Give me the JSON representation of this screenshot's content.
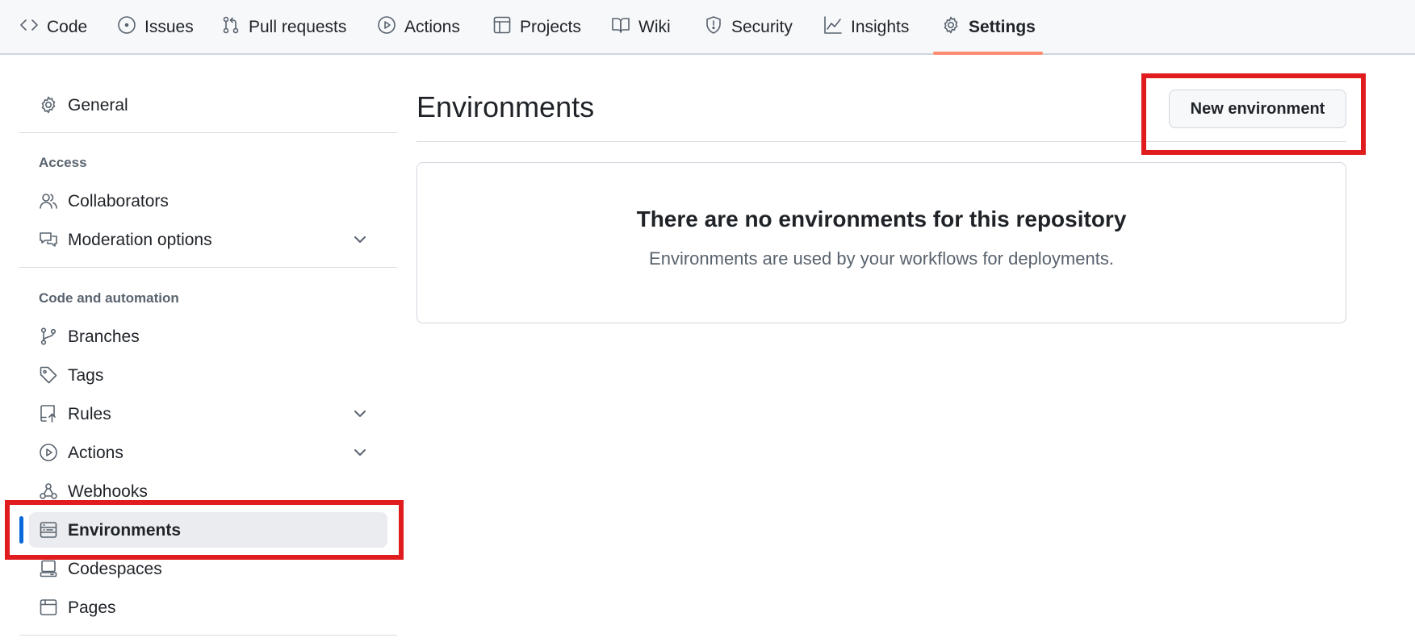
{
  "topnav": {
    "tabs": [
      {
        "label": "Code",
        "icon": "code-icon"
      },
      {
        "label": "Issues",
        "icon": "issue-opened-icon"
      },
      {
        "label": "Pull requests",
        "icon": "git-pull-request-icon"
      },
      {
        "label": "Actions",
        "icon": "play-icon"
      },
      {
        "label": "Projects",
        "icon": "table-icon"
      },
      {
        "label": "Wiki",
        "icon": "book-icon"
      },
      {
        "label": "Security",
        "icon": "shield-icon"
      },
      {
        "label": "Insights",
        "icon": "graph-icon"
      },
      {
        "label": "Settings",
        "icon": "gear-icon",
        "active": true
      }
    ],
    "active_color": "#fd8c73"
  },
  "sidebar": {
    "general": "General",
    "access_heading": "Access",
    "collaborators": "Collaborators",
    "moderation": "Moderation options",
    "code_heading": "Code and automation",
    "branches": "Branches",
    "tags": "Tags",
    "rules": "Rules",
    "actions": "Actions",
    "webhooks": "Webhooks",
    "environments": "Environments",
    "codespaces": "Codespaces",
    "pages": "Pages",
    "selected_color": "#0969da"
  },
  "main": {
    "title": "Environments",
    "new_button": "New environment",
    "empty_title": "There are no environments for this repository",
    "empty_subtitle": "Environments are used by your workflows for deployments."
  },
  "highlight_color": "#e01c1f"
}
